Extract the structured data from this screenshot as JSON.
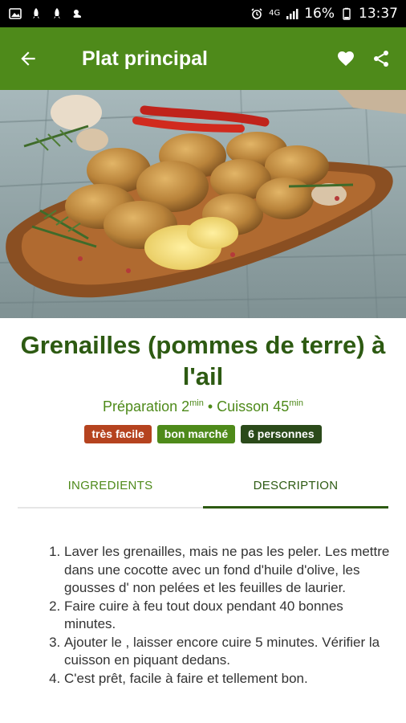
{
  "status_bar": {
    "network": "4G",
    "battery": "16%",
    "time": "13:37"
  },
  "app_bar": {
    "title": "Plat principal"
  },
  "recipe": {
    "title": "Grenailles (pommes de terre) à l'ail",
    "prep_label": "Préparation 2",
    "prep_unit": "min",
    "separator": " • ",
    "cook_label": "Cuisson 45",
    "cook_unit": "min",
    "badges": [
      {
        "label": "très facile",
        "color": "#b5431f"
      },
      {
        "label": "bon marché",
        "color": "#4e8a1a"
      },
      {
        "label": "6 personnes",
        "color": "#2b4a1a"
      }
    ]
  },
  "tabs": [
    {
      "label": "INGREDIENTS",
      "active": false
    },
    {
      "label": "DESCRIPTION",
      "active": true
    }
  ],
  "steps": [
    "Laver les grenailles, mais ne pas les peler. Les mettre dans une cocotte avec un fond d'huile d'olive, les gousses d' non pelées et les feuilles de laurier.",
    "Faire cuire à feu tout doux pendant 40 bonnes minutes.",
    "Ajouter le , laisser encore cuire 5 minutes. Vérifier la cuisson en piquant dedans.",
    "C'est prêt, facile à faire et tellement bon."
  ],
  "colors": {
    "primary": "#4e8a1a",
    "primary_dark": "#2d5a12"
  },
  "icons": {
    "back": "arrow-left-icon",
    "favorite": "heart-icon",
    "share": "share-icon"
  }
}
